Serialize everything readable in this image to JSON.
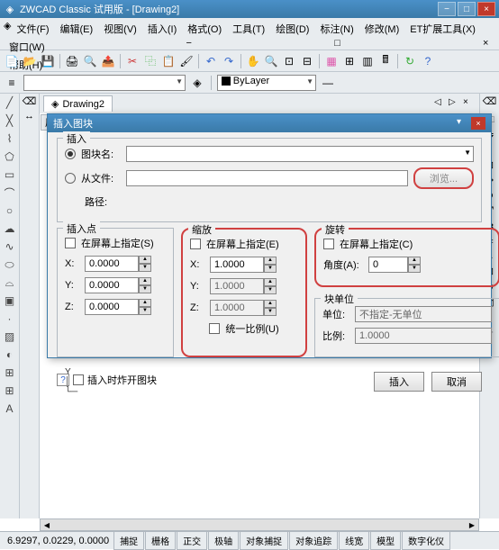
{
  "titlebar": {
    "title": "ZWCAD Classic 试用版 - [Drawing2]"
  },
  "menu": {
    "file": "文件(F)",
    "edit": "编辑(E)",
    "view": "视图(V)",
    "insert": "插入(I)",
    "format": "格式(O)",
    "tools": "工具(T)",
    "draw": "绘图(D)",
    "annotate": "标注(N)",
    "modify": "修改(M)",
    "ettools": "ET扩展工具(X)",
    "window": "窗口(W)",
    "help": "帮助(H)"
  },
  "layer": {
    "bylayer": "ByLayer"
  },
  "doctab": {
    "name": "Drawing2"
  },
  "panel": {
    "properties": "属性"
  },
  "dialog": {
    "title": "插入图块",
    "insert_group": "插入",
    "name_radio": "图块名:",
    "file_radio": "从文件:",
    "browse": "浏览...",
    "path_label": "路径:",
    "insertpt": {
      "group": "插入点",
      "onscreen": "在屏幕上指定(S)",
      "x": "X:",
      "y": "Y:",
      "z": "Z:",
      "xv": "0.0000",
      "yv": "0.0000",
      "zv": "0.0000"
    },
    "scale": {
      "group": "缩放",
      "onscreen": "在屏幕上指定(E)",
      "x": "X:",
      "y": "Y:",
      "z": "Z:",
      "xv": "1.0000",
      "yv": "1.0000",
      "zv": "1.0000",
      "uniform": "统一比例(U)"
    },
    "rotate": {
      "group": "旋转",
      "onscreen": "在屏幕上指定(C)",
      "angle_label": "角度(A):",
      "angle": "0"
    },
    "blockunit": {
      "group": "块单位",
      "unit_label": "单位:",
      "unit": "不指定-无单位",
      "ratio_label": "比例:",
      "ratio": "1.0000"
    },
    "explode": "插入时炸开图块",
    "ok": "插入",
    "cancel": "取消"
  },
  "status": {
    "coord": "6.9297, 0.0229, 0.0000",
    "snap": "捕捉",
    "grid": "栅格",
    "ortho": "正交",
    "polar": "极轴",
    "osnap": "对象捕捉",
    "otrack": "对象追踪",
    "lwt": "线宽",
    "model": "模型",
    "dyn": "数字化仪"
  }
}
